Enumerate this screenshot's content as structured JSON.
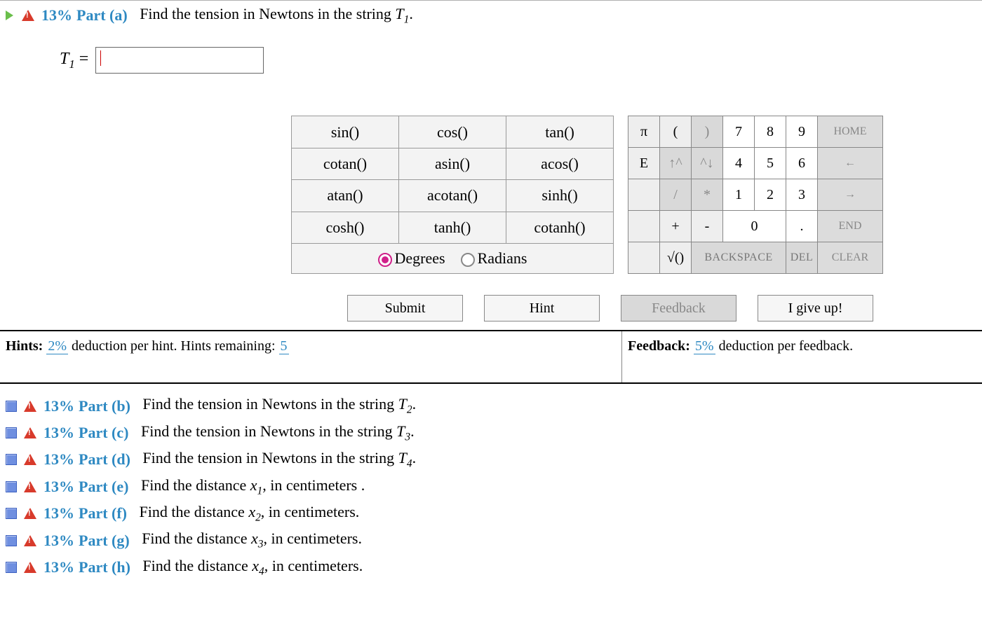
{
  "partA": {
    "percent": "13%",
    "label": "Part (a)",
    "question_prefix": "Find the tension in Newtons in the string ",
    "var": "T",
    "sub": "1",
    "var_label": "T",
    "var_sub": "1",
    "equals": " = "
  },
  "funcs": {
    "r1c1": "sin()",
    "r1c2": "cos()",
    "r1c3": "tan()",
    "r2c1": "cotan()",
    "r2c2": "asin()",
    "r2c3": "acos()",
    "r3c1": "atan()",
    "r3c2": "acotan()",
    "r3c3": "sinh()",
    "r4c1": "cosh()",
    "r4c2": "tanh()",
    "r4c3": "cotanh()",
    "deg": "Degrees",
    "rad": "Radians"
  },
  "pad": {
    "pi": "π",
    "lp": "(",
    "rp": ")",
    "n7": "7",
    "n8": "8",
    "n9": "9",
    "home": "HOME",
    "E": "E",
    "upL": "↑^",
    "upR": "^↓",
    "n4": "4",
    "n5": "5",
    "n6": "6",
    "left": "←",
    "slash": "/",
    "star": "*",
    "n1": "1",
    "n2": "2",
    "n3": "3",
    "right": "→",
    "plus": "+",
    "minus": "-",
    "n0": "0",
    "dot": ".",
    "end": "END",
    "sqrt": "√()",
    "back": "BACKSPACE",
    "del": "DEL",
    "clear": "CLEAR"
  },
  "actions": {
    "submit": "Submit",
    "hint": "Hint",
    "feedback": "Feedback",
    "giveup": "I give up!"
  },
  "deduct": {
    "hints_label": "Hints:",
    "hint_pct": "2%",
    "hint_text": " deduction per hint. Hints remaining: ",
    "hint_remain": "5",
    "fb_label": "Feedback:",
    "fb_pct": "5%",
    "fb_text": " deduction per feedback."
  },
  "parts": [
    {
      "pct": "13%",
      "label": "Part (b)",
      "text": "Find the tension in Newtons in the string ",
      "var": "T",
      "sub": "2",
      "suffix": "."
    },
    {
      "pct": "13%",
      "label": "Part (c)",
      "text": "Find the tension in Newtons in the string ",
      "var": "T",
      "sub": "3",
      "suffix": "."
    },
    {
      "pct": "13%",
      "label": "Part (d)",
      "text": "Find the tension in Newtons in the string ",
      "var": "T",
      "sub": "4",
      "suffix": "."
    },
    {
      "pct": "13%",
      "label": "Part (e)",
      "text": "Find the distance ",
      "var": "x",
      "sub": "1",
      "suffix": ", in centimeters ."
    },
    {
      "pct": "13%",
      "label": "Part (f)",
      "text": "Find the distance ",
      "var": "x",
      "sub": "2",
      "suffix": ", in centimeters."
    },
    {
      "pct": "13%",
      "label": "Part (g)",
      "text": "Find the distance ",
      "var": "x",
      "sub": "3",
      "suffix": ", in centimeters."
    },
    {
      "pct": "13%",
      "label": "Part (h)",
      "text": "Find the distance ",
      "var": "x",
      "sub": "4",
      "suffix": ", in centimeters."
    }
  ]
}
